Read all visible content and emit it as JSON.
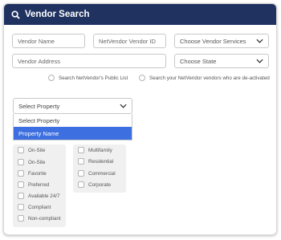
{
  "header": {
    "title": "Vendor Search",
    "icon": "search-icon",
    "bg_color": "#1f3260"
  },
  "fields": {
    "vendor_name": {
      "placeholder": "Vendor Name"
    },
    "netvendor_id": {
      "placeholder": "NetVendor Vendor ID"
    },
    "services": {
      "value": "Choose Vendor Services"
    },
    "address": {
      "placeholder": "Vendor Address"
    },
    "state": {
      "value": "Choose State"
    }
  },
  "checks": {
    "public_list": "Search NetVendor's Public List",
    "deactivated": "Search your NetVendor vendors who are de-activated"
  },
  "property": {
    "selected": "Select Property",
    "options": [
      "Select Property",
      "Property Name"
    ],
    "highlight_color": "#3d6fe0"
  },
  "filters": {
    "left": [
      "On-Site",
      "On-Site",
      "Favorite",
      "Preferred",
      "Available 24/7",
      "Compliant",
      "Non-compliant"
    ],
    "right": [
      "Multifamily",
      "Residential",
      "Commercial",
      "Corporate"
    ]
  }
}
